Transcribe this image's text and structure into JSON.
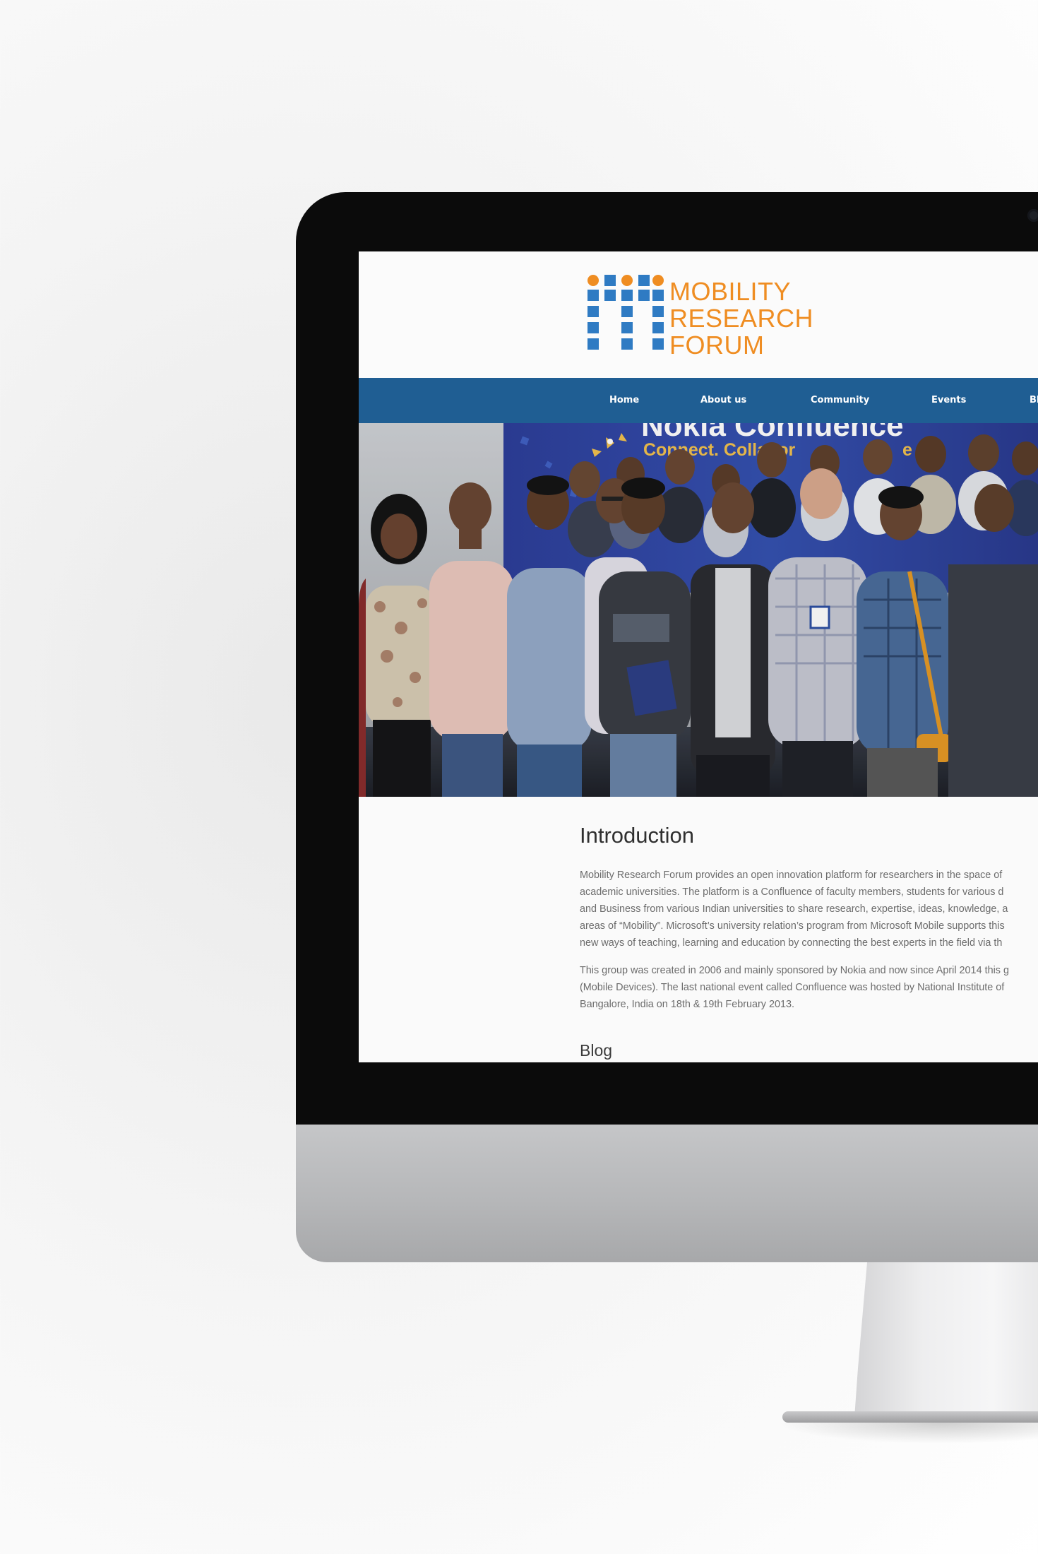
{
  "logo": {
    "line1": "MOBILITY",
    "line2": "RESEARCH",
    "line3": "FORUM",
    "text_color": "#ef8d22",
    "mark_blue": "#2f7bc3",
    "mark_orange": "#ef8d22"
  },
  "nav": {
    "background": "#1f5e93",
    "items": [
      {
        "label": "Home"
      },
      {
        "label": "About us"
      },
      {
        "label": "Community"
      },
      {
        "label": "Events"
      },
      {
        "label": "Bl"
      }
    ]
  },
  "hero": {
    "banner_line1": "Nokia Confluence",
    "banner_line2": "Connect. Collabor",
    "banner_line2_end": "e"
  },
  "intro": {
    "title": "Introduction",
    "paragraph1_lines": [
      "Mobility Research Forum provides an open innovation platform for researchers in the space of",
      "academic universities. The platform is a Confluence of faculty members, students for various d",
      "and Business from various Indian universities to share research, expertise, ideas, knowledge, a",
      "areas of “Mobility”. Microsoft’s university relation’s program from Microsoft Mobile supports this",
      "new ways of teaching, learning and education by connecting the best experts in the field via th"
    ],
    "paragraph2_lines": [
      "This group was created in 2006 and mainly sponsored by Nokia and now since April 2014 this g",
      "(Mobile Devices). The last national event called Confluence was hosted by National Institute of",
      "Bangalore, India on 18th & 19th February 2013."
    ]
  },
  "blog": {
    "title": "Blog"
  }
}
